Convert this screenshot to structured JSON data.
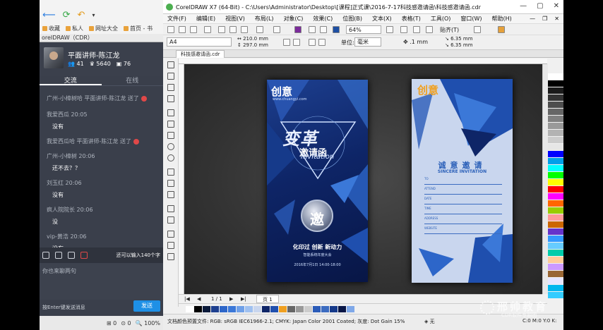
{
  "chat": {
    "bookmarks": [
      "收藏",
      "私人",
      "网址大全",
      "首页 - 书"
    ],
    "tab_label": "oreIDRAW（CDR）",
    "profile": {
      "name": "平面讲师-陈江龙",
      "stat1": "41",
      "stat2": "5640",
      "stat3": "76"
    },
    "tabs": [
      "交流",
      "在线"
    ],
    "messages": [
      {
        "head": "广州-小樟树哈 平面讲师-陈江龙 送了",
        "text": ""
      },
      {
        "head": "我爱西瓜 20:05",
        "text": "没有"
      },
      {
        "head": "我爱西瓜哈 平面讲师-陈江龙 送了",
        "text": ""
      },
      {
        "head": "广州-小樟树 20:06",
        "text": "还不去？？"
      },
      {
        "head": "刘玉红 20:06",
        "text": "没有"
      },
      {
        "head": "疯人院院长 20:06",
        "text": "没"
      },
      {
        "head": "vip-黄浩 20:06",
        "text": "没有"
      }
    ],
    "remaining": "还可以输入140个字",
    "input_placeholder": "你也来聊两句",
    "hint": "按Enter键发送消息",
    "send_label": "发送",
    "status_items": [
      "0",
      "0",
      "100%"
    ]
  },
  "corel": {
    "title": "CorelDRAW X7 (64-Bit) - C:\\Users\\Administrator\\Desktop\\[课程]正式课\\2016-7-17科技感邀请函\\科技感邀请函.cdr",
    "menu": [
      "文件(F)",
      "编辑(E)",
      "视图(V)",
      "布局(L)",
      "对象(C)",
      "效果(C)",
      "位图(B)",
      "文本(X)",
      "表格(T)",
      "工具(O)",
      "窗口(W)",
      "帮助(H)"
    ],
    "zoom": "64%",
    "snap_label": "贴齐(T)",
    "page_size": "A4",
    "width": "210.0 mm",
    "height": "297.0 mm",
    "unit_label": "单位:",
    "unit": "毫米",
    "nudge": ".1 mm",
    "dup_x": "6.35 mm",
    "dup_y": "6.35 mm",
    "doc_tab": "科技感邀请函.cdr",
    "page_counter": "1 / 1",
    "page_tab": "页 1",
    "status_text": "文档颜色预置文件: RGB: sRGB IEC61966-2.1; CMYK: Japan Color 2001 Coated; 灰度: Dot Gain 15%",
    "status_fill": "无",
    "status_coords": "C:0 M:0 Y:0 K:"
  },
  "card_front": {
    "logo": "创意",
    "url": "www.chuangyi.com",
    "headline": "变革",
    "subtitle": "邀请函",
    "invitation": "Invitation",
    "seal": "邀",
    "slogan": "化印过 创新 新动力",
    "event": "智能系统年度大会",
    "date": "2016年7月1日  14:00-18:00"
  },
  "card_back": {
    "logo": "创意",
    "title": "诚意邀请",
    "subtitle": "SINCERE INVITATION",
    "fields": [
      "TO",
      "ATTEND",
      "DATE",
      "TIME",
      "ADDRESS",
      "WEBSITE"
    ]
  },
  "watermark": {
    "big": "邢帅教育",
    "small": "CDR软件专题团"
  },
  "colors": {
    "accent": "#1e90e6",
    "chat_bg": "#3a3f4b",
    "card_blue": "#1d3f8f"
  }
}
